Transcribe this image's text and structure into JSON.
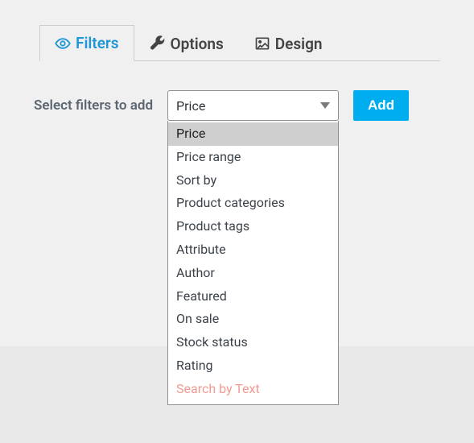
{
  "tabs": [
    {
      "label": "Filters",
      "icon": "eye-icon"
    },
    {
      "label": "Options",
      "icon": "wrench-icon"
    },
    {
      "label": "Design",
      "icon": "image-icon"
    }
  ],
  "filters": {
    "label": "Select filters to add",
    "selected": "Price",
    "options": [
      "Price",
      "Price range",
      "Sort by",
      "Product categories",
      "Product tags",
      "Attribute",
      "Author",
      "Featured",
      "On sale",
      "Stock status",
      "Rating",
      "Search by Text"
    ],
    "add_button": "Add"
  }
}
